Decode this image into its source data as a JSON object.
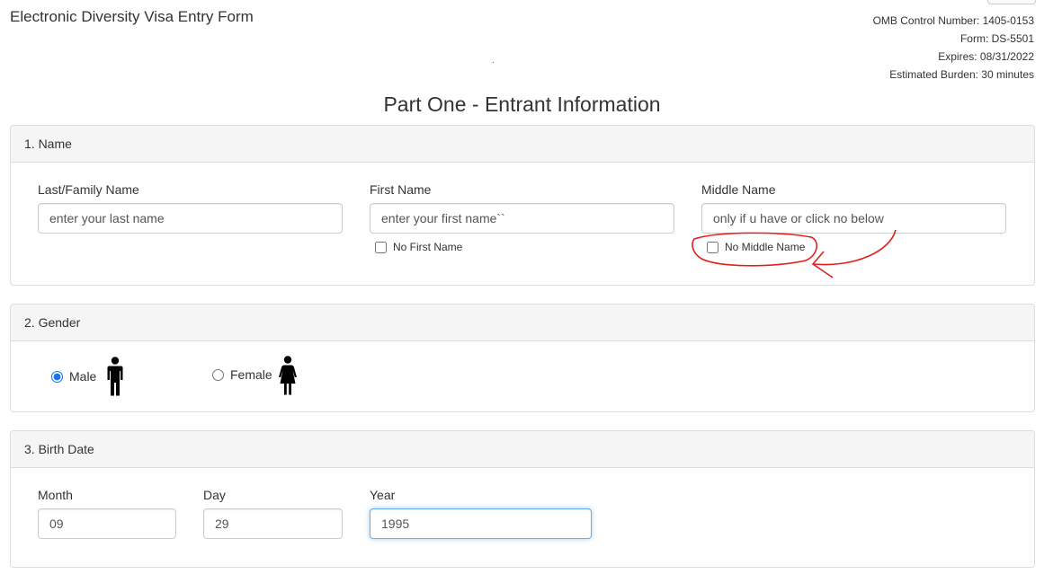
{
  "header": {
    "title": "Electronic Diversity Visa Entry Form",
    "meta": {
      "omb": "OMB Control Number: 1405-0153",
      "form": "Form: DS-5501",
      "expires": "Expires: 08/31/2022",
      "burden": "Estimated Burden: 30 minutes"
    },
    "dot": "."
  },
  "part_title": "Part One - Entrant Information",
  "name_section": {
    "heading": "1. Name",
    "last_label": "Last/Family Name",
    "last_placeholder": "enter your last name",
    "first_label": "First Name",
    "first_placeholder": "enter your first name``",
    "middle_label": "Middle Name",
    "middle_placeholder": "only if u have or click no below",
    "no_first_label": "No First Name",
    "no_middle_label": "No Middle Name"
  },
  "gender_section": {
    "heading": "2. Gender",
    "male_label": "Male",
    "female_label": "Female",
    "selected": "Male"
  },
  "birth_section": {
    "heading": "3. Birth Date",
    "month_label": "Month",
    "month_value": "09",
    "day_label": "Day",
    "day_value": "29",
    "year_label": "Year",
    "year_value": "1995"
  },
  "colors": {
    "annotation": "#e0201b",
    "focus": "#66afe9",
    "panel_heading_bg": "#f5f5f5"
  }
}
